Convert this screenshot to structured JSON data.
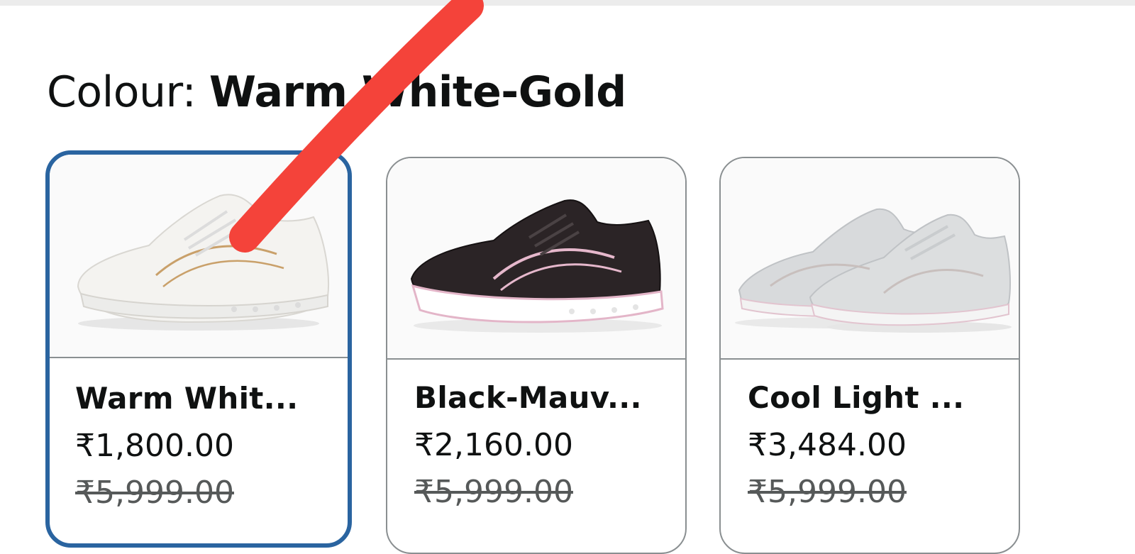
{
  "colour": {
    "label": "Colour: ",
    "selected_value": "Warm White-Gold"
  },
  "swatches": [
    {
      "name": "Warm Whit...",
      "price": "₹1,800.00",
      "mrp": "₹5,999.00",
      "selected": true,
      "image_icon": "white-gold-sneaker"
    },
    {
      "name": "Black-Mauv...",
      "price": "₹2,160.00",
      "mrp": "₹5,999.00",
      "selected": false,
      "image_icon": "black-mauve-sneaker"
    },
    {
      "name": "Cool Light ...",
      "price": "₹3,484.00",
      "mrp": "₹5,999.00",
      "selected": false,
      "image_icon": "cool-light-grey-sneaker-pair"
    }
  ],
  "colors": {
    "selected_border": "#2a64a0",
    "card_border": "#8a8f91",
    "strikethrough_price": "#565959",
    "annotation_stroke": "#f4433a"
  }
}
